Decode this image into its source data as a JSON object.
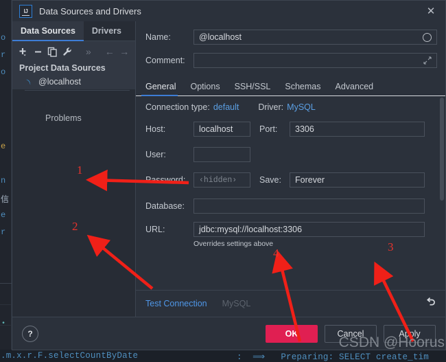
{
  "window": {
    "title": "Data Sources and Drivers",
    "logo_text": "IJ",
    "close_icon": "✕"
  },
  "left_panel": {
    "tabs": [
      {
        "label": "Data Sources",
        "active": true
      },
      {
        "label": "Drivers",
        "active": false
      }
    ],
    "toolbar": [
      {
        "name": "add-icon",
        "glyph": "＋",
        "dim": false
      },
      {
        "name": "remove-icon",
        "glyph": "−",
        "dim": false
      },
      {
        "name": "copy-icon",
        "glyph": "❐",
        "dim": false
      },
      {
        "name": "wrench-icon",
        "glyph": "🔧",
        "dim": false
      },
      {
        "name": "more-icon",
        "glyph": "»",
        "dim": true
      },
      {
        "name": "back-arrow-icon",
        "glyph": "←",
        "dim": true
      },
      {
        "name": "forward-arrow-icon",
        "glyph": "→",
        "dim": true
      }
    ],
    "group_header": "Project Data Sources",
    "items": [
      {
        "label": "@localhost",
        "icon": "mysql-dolphin-icon"
      }
    ],
    "problems_label": "Problems"
  },
  "header_fields": {
    "name_label": "Name:",
    "name_value": "@localhost",
    "name_end_icon": "circle-icon",
    "comment_label": "Comment:",
    "comment_value": "",
    "comment_end_icon": "expand-icon"
  },
  "subtabs": [
    {
      "label": "General",
      "active": true
    },
    {
      "label": "Options",
      "active": false
    },
    {
      "label": "SSH/SSL",
      "active": false
    },
    {
      "label": "Schemas",
      "active": false
    },
    {
      "label": "Advanced",
      "active": false
    }
  ],
  "connection": {
    "type_label": "Connection type:",
    "type_value": "default",
    "driver_label": "Driver:",
    "driver_value": "MySQL"
  },
  "form": {
    "host_label": "Host:",
    "host_value": "localhost",
    "port_label": "Port:",
    "port_value": "3306",
    "user_label": "User:",
    "user_value": "",
    "password_label": "Password:",
    "password_placeholder": "‹hidden›",
    "save_label": "Save:",
    "save_value": "Forever",
    "database_label": "Database:",
    "database_value": "",
    "url_label": "URL:",
    "url_value": "jdbc:mysql://localhost:3306",
    "url_hint": "Overrides settings above"
  },
  "actions": {
    "test_connection": "Test Connection",
    "driver_status": "MySQL",
    "reset_icon": "undo-icon"
  },
  "footer": {
    "help_label": "?",
    "ok_label": "OK",
    "cancel_label": "Cancel",
    "apply_label": "Apply"
  },
  "annotations": {
    "numbers": [
      "1",
      "2",
      "3",
      "4"
    ],
    "color": "#e8332d"
  },
  "watermark": "CSDN @Hoorus",
  "background_code": {
    "left_fragments": [
      "o",
      "r",
      "o",
      "e",
      "n",
      "信",
      "e",
      "r"
    ],
    "bottom_left": ".m.x.r.F.selectCountByDate",
    "bottom_right": ":  ⟹   Preparing: SELECT create_tim"
  }
}
